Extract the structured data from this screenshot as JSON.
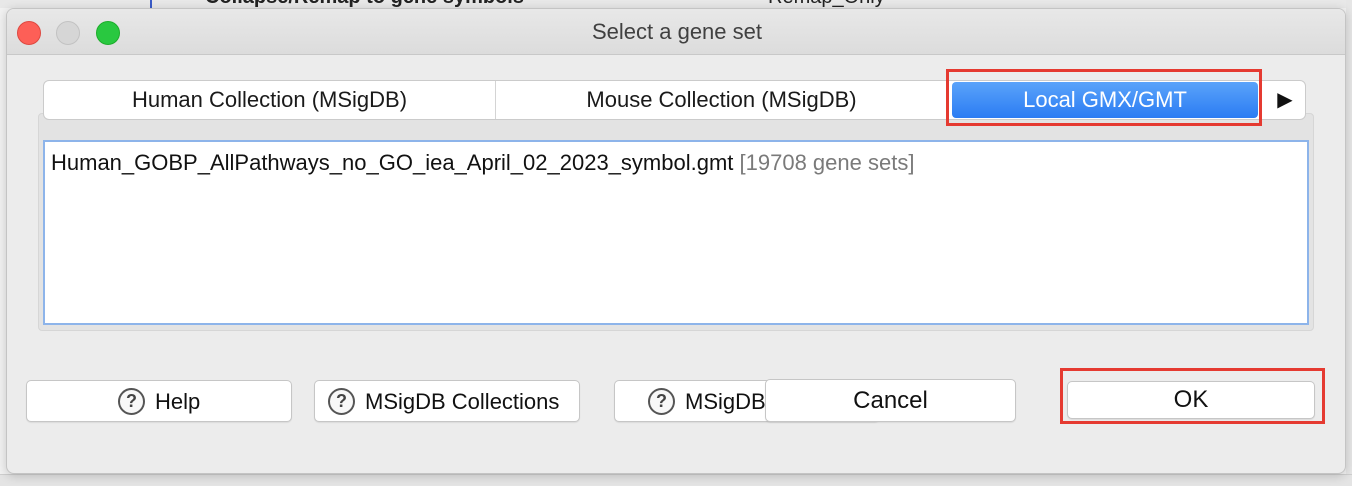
{
  "background": {
    "left_text": "Collapse/Remap to gene symbols",
    "right_text": "Remap_Only"
  },
  "dialog": {
    "title": "Select a gene set"
  },
  "tabs": [
    {
      "label": "Human Collection (MSigDB)",
      "selected": false
    },
    {
      "label": "Mouse Collection (MSigDB)",
      "selected": false
    },
    {
      "label": "Local GMX/GMT",
      "selected": true
    }
  ],
  "tab_scroll_icon": "right-triangle-icon",
  "gene_sets": [
    {
      "filename": "Human_GOBP_AllPathways_no_GO_iea_April_02_2023_symbol.gmt",
      "count": "[19708 gene sets]"
    }
  ],
  "buttons": {
    "help": "Help",
    "msigdb_collections": "MSigDB Collections",
    "msigdb": "MSigDB",
    "cancel": "Cancel",
    "ok": "OK"
  },
  "icons": {
    "help": "question-circle-icon"
  },
  "colors": {
    "selected_tab": "#2b7cf3",
    "highlight": "#e53a31",
    "close": "#fd5f57",
    "maximize": "#29c840"
  }
}
